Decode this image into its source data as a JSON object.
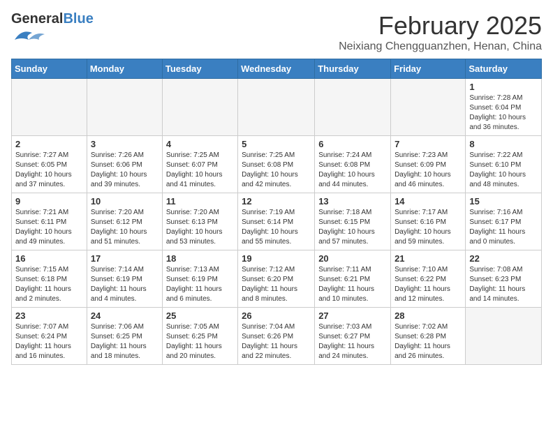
{
  "header": {
    "logo_general": "General",
    "logo_blue": "Blue",
    "month_title": "February 2025",
    "location": "Neixiang Chengguanzhen, Henan, China"
  },
  "days_of_week": [
    "Sunday",
    "Monday",
    "Tuesday",
    "Wednesday",
    "Thursday",
    "Friday",
    "Saturday"
  ],
  "weeks": [
    [
      {
        "day": "",
        "info": ""
      },
      {
        "day": "",
        "info": ""
      },
      {
        "day": "",
        "info": ""
      },
      {
        "day": "",
        "info": ""
      },
      {
        "day": "",
        "info": ""
      },
      {
        "day": "",
        "info": ""
      },
      {
        "day": "1",
        "info": "Sunrise: 7:28 AM\nSunset: 6:04 PM\nDaylight: 10 hours and 36 minutes."
      }
    ],
    [
      {
        "day": "2",
        "info": "Sunrise: 7:27 AM\nSunset: 6:05 PM\nDaylight: 10 hours and 37 minutes."
      },
      {
        "day": "3",
        "info": "Sunrise: 7:26 AM\nSunset: 6:06 PM\nDaylight: 10 hours and 39 minutes."
      },
      {
        "day": "4",
        "info": "Sunrise: 7:25 AM\nSunset: 6:07 PM\nDaylight: 10 hours and 41 minutes."
      },
      {
        "day": "5",
        "info": "Sunrise: 7:25 AM\nSunset: 6:08 PM\nDaylight: 10 hours and 42 minutes."
      },
      {
        "day": "6",
        "info": "Sunrise: 7:24 AM\nSunset: 6:08 PM\nDaylight: 10 hours and 44 minutes."
      },
      {
        "day": "7",
        "info": "Sunrise: 7:23 AM\nSunset: 6:09 PM\nDaylight: 10 hours and 46 minutes."
      },
      {
        "day": "8",
        "info": "Sunrise: 7:22 AM\nSunset: 6:10 PM\nDaylight: 10 hours and 48 minutes."
      }
    ],
    [
      {
        "day": "9",
        "info": "Sunrise: 7:21 AM\nSunset: 6:11 PM\nDaylight: 10 hours and 49 minutes."
      },
      {
        "day": "10",
        "info": "Sunrise: 7:20 AM\nSunset: 6:12 PM\nDaylight: 10 hours and 51 minutes."
      },
      {
        "day": "11",
        "info": "Sunrise: 7:20 AM\nSunset: 6:13 PM\nDaylight: 10 hours and 53 minutes."
      },
      {
        "day": "12",
        "info": "Sunrise: 7:19 AM\nSunset: 6:14 PM\nDaylight: 10 hours and 55 minutes."
      },
      {
        "day": "13",
        "info": "Sunrise: 7:18 AM\nSunset: 6:15 PM\nDaylight: 10 hours and 57 minutes."
      },
      {
        "day": "14",
        "info": "Sunrise: 7:17 AM\nSunset: 6:16 PM\nDaylight: 10 hours and 59 minutes."
      },
      {
        "day": "15",
        "info": "Sunrise: 7:16 AM\nSunset: 6:17 PM\nDaylight: 11 hours and 0 minutes."
      }
    ],
    [
      {
        "day": "16",
        "info": "Sunrise: 7:15 AM\nSunset: 6:18 PM\nDaylight: 11 hours and 2 minutes."
      },
      {
        "day": "17",
        "info": "Sunrise: 7:14 AM\nSunset: 6:19 PM\nDaylight: 11 hours and 4 minutes."
      },
      {
        "day": "18",
        "info": "Sunrise: 7:13 AM\nSunset: 6:19 PM\nDaylight: 11 hours and 6 minutes."
      },
      {
        "day": "19",
        "info": "Sunrise: 7:12 AM\nSunset: 6:20 PM\nDaylight: 11 hours and 8 minutes."
      },
      {
        "day": "20",
        "info": "Sunrise: 7:11 AM\nSunset: 6:21 PM\nDaylight: 11 hours and 10 minutes."
      },
      {
        "day": "21",
        "info": "Sunrise: 7:10 AM\nSunset: 6:22 PM\nDaylight: 11 hours and 12 minutes."
      },
      {
        "day": "22",
        "info": "Sunrise: 7:08 AM\nSunset: 6:23 PM\nDaylight: 11 hours and 14 minutes."
      }
    ],
    [
      {
        "day": "23",
        "info": "Sunrise: 7:07 AM\nSunset: 6:24 PM\nDaylight: 11 hours and 16 minutes."
      },
      {
        "day": "24",
        "info": "Sunrise: 7:06 AM\nSunset: 6:25 PM\nDaylight: 11 hours and 18 minutes."
      },
      {
        "day": "25",
        "info": "Sunrise: 7:05 AM\nSunset: 6:25 PM\nDaylight: 11 hours and 20 minutes."
      },
      {
        "day": "26",
        "info": "Sunrise: 7:04 AM\nSunset: 6:26 PM\nDaylight: 11 hours and 22 minutes."
      },
      {
        "day": "27",
        "info": "Sunrise: 7:03 AM\nSunset: 6:27 PM\nDaylight: 11 hours and 24 minutes."
      },
      {
        "day": "28",
        "info": "Sunrise: 7:02 AM\nSunset: 6:28 PM\nDaylight: 11 hours and 26 minutes."
      },
      {
        "day": "",
        "info": ""
      }
    ]
  ]
}
